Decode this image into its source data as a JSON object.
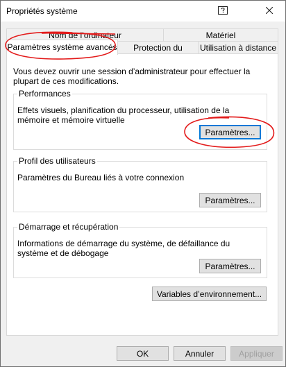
{
  "window": {
    "title": "Propriétés système",
    "icons": {
      "help": "help-icon",
      "close": "close-icon"
    }
  },
  "tabs": {
    "row1": [
      "Nom de l’ordinateur",
      "Matériel"
    ],
    "row2": [
      "Paramètres système avancés",
      "Protection du système",
      "Utilisation à distance"
    ],
    "active": "Paramètres système avancés"
  },
  "intro_text": "Vous devez ouvrir une session d’administrateur pour effectuer la plupart de ces modifications.",
  "performance": {
    "title": "Performances",
    "description": "Effets visuels, planification du processeur, utilisation de la mémoire et mémoire virtuelle",
    "button": "Paramètres..."
  },
  "user_profiles": {
    "title": "Profil des utilisateurs",
    "description": "Paramètres du Bureau liés à votre connexion",
    "button": "Paramètres..."
  },
  "startup_recovery": {
    "title": "Démarrage et récupération",
    "description": "Informations de démarrage du système, de défaillance du système et de débogage",
    "button": "Paramètres..."
  },
  "env_button": "Variables d’environnement...",
  "footer": {
    "ok": "OK",
    "cancel": "Annuler",
    "apply": "Appliquer"
  },
  "annotation_color": "#e31b1b"
}
